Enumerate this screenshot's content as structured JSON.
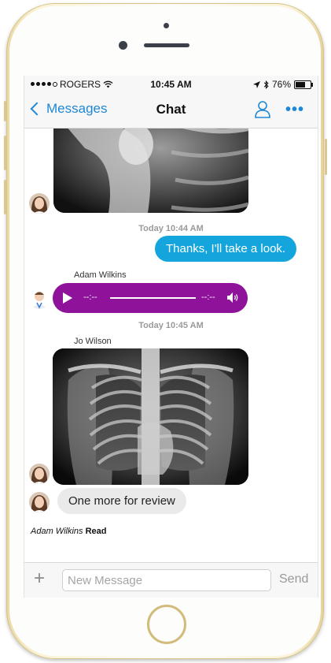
{
  "statusbar": {
    "carrier": "ROGERS",
    "time": "10:45 AM",
    "battery": "76%",
    "battery_level": 0.76
  },
  "navbar": {
    "back_label": "Messages",
    "title": "Chat"
  },
  "chat": {
    "messages": [
      {
        "type": "timestamp",
        "text": "Today 10:44 AM"
      },
      {
        "type": "outgoing",
        "text": "Thanks, I'll take a look."
      },
      {
        "type": "sender",
        "text": "Adam Wilkins"
      },
      {
        "type": "audio",
        "time_left": "--:--",
        "time_right": "--:--"
      },
      {
        "type": "timestamp",
        "text": "Today 10:45 AM"
      },
      {
        "type": "sender",
        "text": "Jo Wilson"
      },
      {
        "type": "incoming",
        "text": "One more for review"
      }
    ],
    "read_receipt": {
      "name": "Adam Wilkins",
      "status": "Read"
    }
  },
  "input": {
    "placeholder": "New Message",
    "send_label": "Send"
  },
  "colors": {
    "accent": "#1e88d6",
    "outgoing_bubble": "#13a5dc",
    "audio_bubble": "#8e139a",
    "incoming_bubble": "#eaeaea"
  },
  "icons": [
    "signal-dots-icon",
    "wifi-icon",
    "location-arrow-icon",
    "bluetooth-icon",
    "battery-icon",
    "chevron-left-icon",
    "user-profile-icon",
    "more-options-icon",
    "play-icon",
    "volume-icon",
    "plus-icon"
  ]
}
